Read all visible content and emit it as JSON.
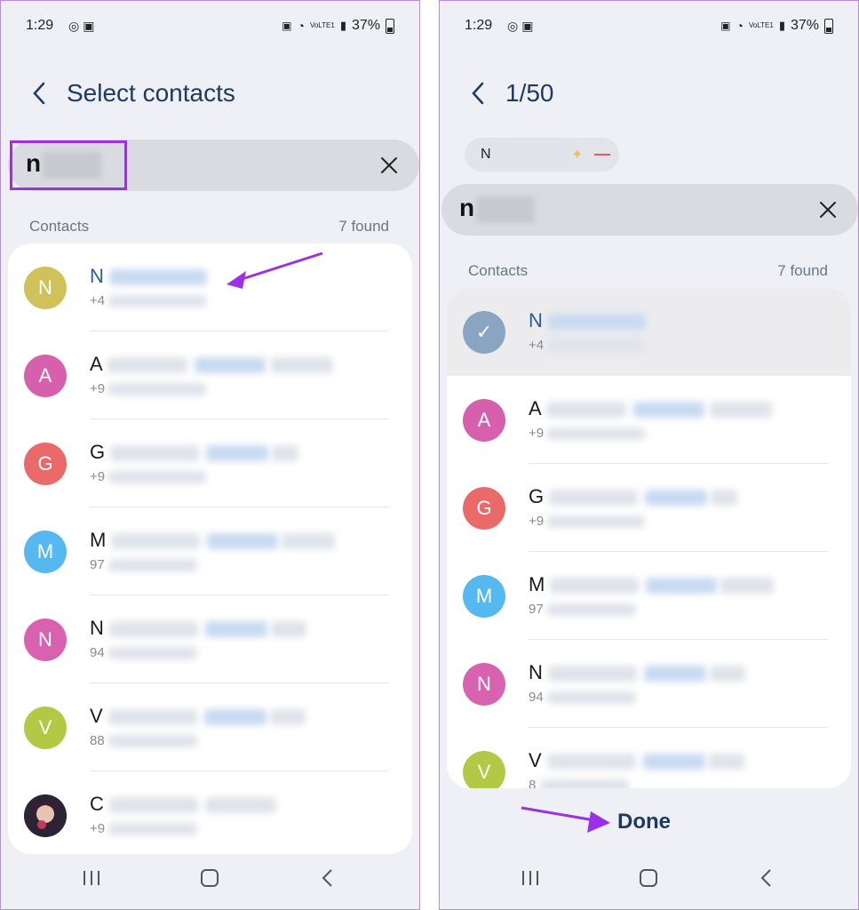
{
  "status": {
    "time": "1:29",
    "battery": "37%",
    "network": "VoLTE1"
  },
  "left": {
    "title": "Select contacts",
    "search": {
      "value": "n"
    },
    "section": {
      "label": "Contacts",
      "count": "7 found"
    },
    "contacts": [
      {
        "initial": "N",
        "name": "N",
        "number": "+4",
        "color": "#cfc25a"
      },
      {
        "initial": "A",
        "name": "A",
        "number": "+9",
        "color": "#d65fae"
      },
      {
        "initial": "G",
        "name": "G",
        "number": "+9",
        "color": "#ea6a6a"
      },
      {
        "initial": "M",
        "name": "M",
        "number": "97",
        "color": "#55b8ee"
      },
      {
        "initial": "N",
        "name": "N",
        "number": "94",
        "color": "#d862b0"
      },
      {
        "initial": "V",
        "name": "V",
        "number": "88",
        "color": "#b3c845"
      },
      {
        "initial": "",
        "name": "C",
        "number": "+9",
        "color": "#3a3046"
      }
    ]
  },
  "right": {
    "title": "1/50",
    "chip": {
      "label": "N"
    },
    "search": {
      "value": "n"
    },
    "section": {
      "label": "Contacts",
      "count": "7 found"
    },
    "contacts": [
      {
        "initial": "✓",
        "name": "N",
        "number": "+4",
        "color": "#8aa4c4",
        "selected": true
      },
      {
        "initial": "A",
        "name": "A",
        "number": "+9",
        "color": "#d65fae"
      },
      {
        "initial": "G",
        "name": "G",
        "number": "+9",
        "color": "#ea6a6a"
      },
      {
        "initial": "M",
        "name": "M",
        "number": "97",
        "color": "#55b8ee"
      },
      {
        "initial": "N",
        "name": "N",
        "number": "94",
        "color": "#d862b0"
      },
      {
        "initial": "V",
        "name": "V",
        "number": "8",
        "color": "#b3c845"
      }
    ],
    "done_label": "Done"
  },
  "colors": {
    "accent": "#9b30e6",
    "title": "#1d3a63"
  },
  "icons": [
    "back-icon",
    "close-icon",
    "check-icon",
    "recents-icon",
    "home-icon",
    "nav-back-icon"
  ]
}
